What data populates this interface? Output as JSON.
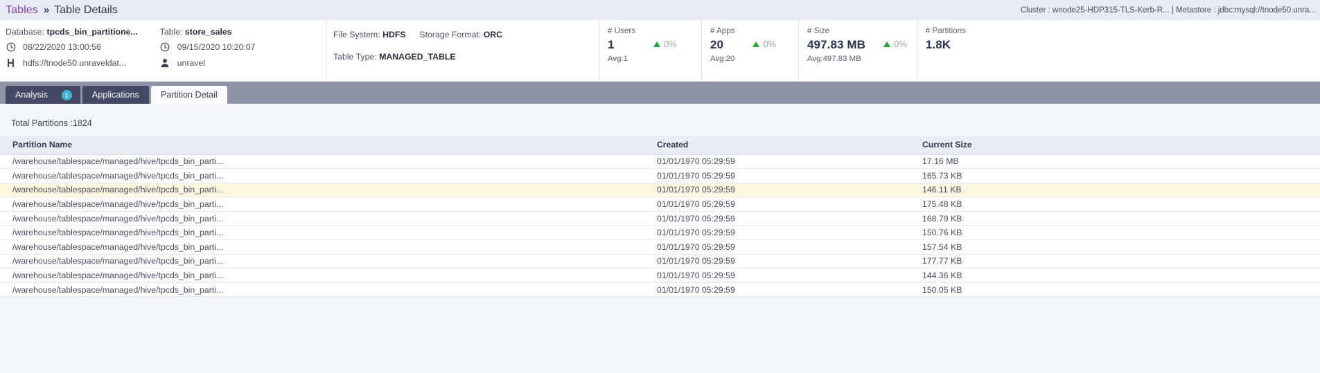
{
  "breadcrumb": {
    "root": "Tables",
    "separator": "»",
    "current": "Table Details"
  },
  "cluster_info": "Cluster : wnode25-HDP315-TLS-Kerb-R... | Metastore : jdbc:mysql://tnode50.unra...",
  "summary": {
    "database_label": "Database:",
    "database_value": "tpcds_bin_partitione...",
    "database_date": "08/22/2020 13:00:56",
    "database_path": "hdfs://tnode50.unraveldat...",
    "table_label": "Table:",
    "table_value": "store_sales",
    "table_date": "09/15/2020 10:20:07",
    "table_owner": "unravel",
    "file_system_label": "File System:",
    "file_system_value": "HDFS",
    "storage_format_label": "Storage Format:",
    "storage_format_value": "ORC",
    "table_type_label": "Table Type:",
    "table_type_value": "MANAGED_TABLE"
  },
  "stats": [
    {
      "label": "# Users",
      "value": "1",
      "avg": "Avg:1",
      "delta": "0%",
      "delta_dir": "up"
    },
    {
      "label": "# Apps",
      "value": "20",
      "avg": "Avg:20",
      "delta": "0%",
      "delta_dir": "up"
    },
    {
      "label": "# Size",
      "value": "497.83 MB",
      "avg": "Avg:497.83 MB",
      "delta": "0%",
      "delta_dir": "up"
    },
    {
      "label": "# Partitions",
      "value": "1.8K",
      "avg": "",
      "delta": "",
      "delta_dir": ""
    }
  ],
  "colors": {
    "breadcrumb_bg": "#e8ebf5",
    "crumb_link": "#7b43a1",
    "tabstrip_bg": "#8f93a8",
    "tab_inactive_bg": "#454965",
    "tab_active_bg": "#fbfcfd",
    "badge_bg": "#3cb6d4",
    "delta_green": "#22a43b",
    "row_highlight": "#fdf6e0",
    "header_row_bg": "#e9ecf4"
  },
  "tabs": [
    {
      "label": "Analysis",
      "badge": "1",
      "active": false
    },
    {
      "label": "Applications",
      "badge": "",
      "active": false
    },
    {
      "label": "Partition Detail",
      "badge": "",
      "active": true
    }
  ],
  "partition_table": {
    "total_line": "Total Partitions :1824",
    "columns": [
      "Partition Name",
      "Created",
      "Current Size"
    ],
    "rows": [
      {
        "name": "/warehouse/tablespace/managed/hive/tpcds_bin_parti...",
        "created": "01/01/1970 05:29:59",
        "size": "17.16 MB",
        "highlight": false
      },
      {
        "name": "/warehouse/tablespace/managed/hive/tpcds_bin_parti...",
        "created": "01/01/1970 05:29:59",
        "size": "165.73 KB",
        "highlight": false
      },
      {
        "name": "/warehouse/tablespace/managed/hive/tpcds_bin_parti...",
        "created": "01/01/1970 05:29:59",
        "size": "146.11 KB",
        "highlight": true
      },
      {
        "name": "/warehouse/tablespace/managed/hive/tpcds_bin_parti...",
        "created": "01/01/1970 05:29:59",
        "size": "175.48 KB",
        "highlight": false
      },
      {
        "name": "/warehouse/tablespace/managed/hive/tpcds_bin_parti...",
        "created": "01/01/1970 05:29:59",
        "size": "168.79 KB",
        "highlight": false
      },
      {
        "name": "/warehouse/tablespace/managed/hive/tpcds_bin_parti...",
        "created": "01/01/1970 05:29:59",
        "size": "150.76 KB",
        "highlight": false
      },
      {
        "name": "/warehouse/tablespace/managed/hive/tpcds_bin_parti...",
        "created": "01/01/1970 05:29:59",
        "size": "157.54 KB",
        "highlight": false
      },
      {
        "name": "/warehouse/tablespace/managed/hive/tpcds_bin_parti...",
        "created": "01/01/1970 05:29:59",
        "size": "177.77 KB",
        "highlight": false
      },
      {
        "name": "/warehouse/tablespace/managed/hive/tpcds_bin_parti...",
        "created": "01/01/1970 05:29:59",
        "size": "144.36 KB",
        "highlight": false
      },
      {
        "name": "/warehouse/tablespace/managed/hive/tpcds_bin_parti...",
        "created": "01/01/1970 05:29:59",
        "size": "150.05 KB",
        "highlight": false
      }
    ]
  },
  "icons": {
    "clock": "clock-icon",
    "hdfs": "hdfs-icon",
    "user": "user-icon"
  }
}
